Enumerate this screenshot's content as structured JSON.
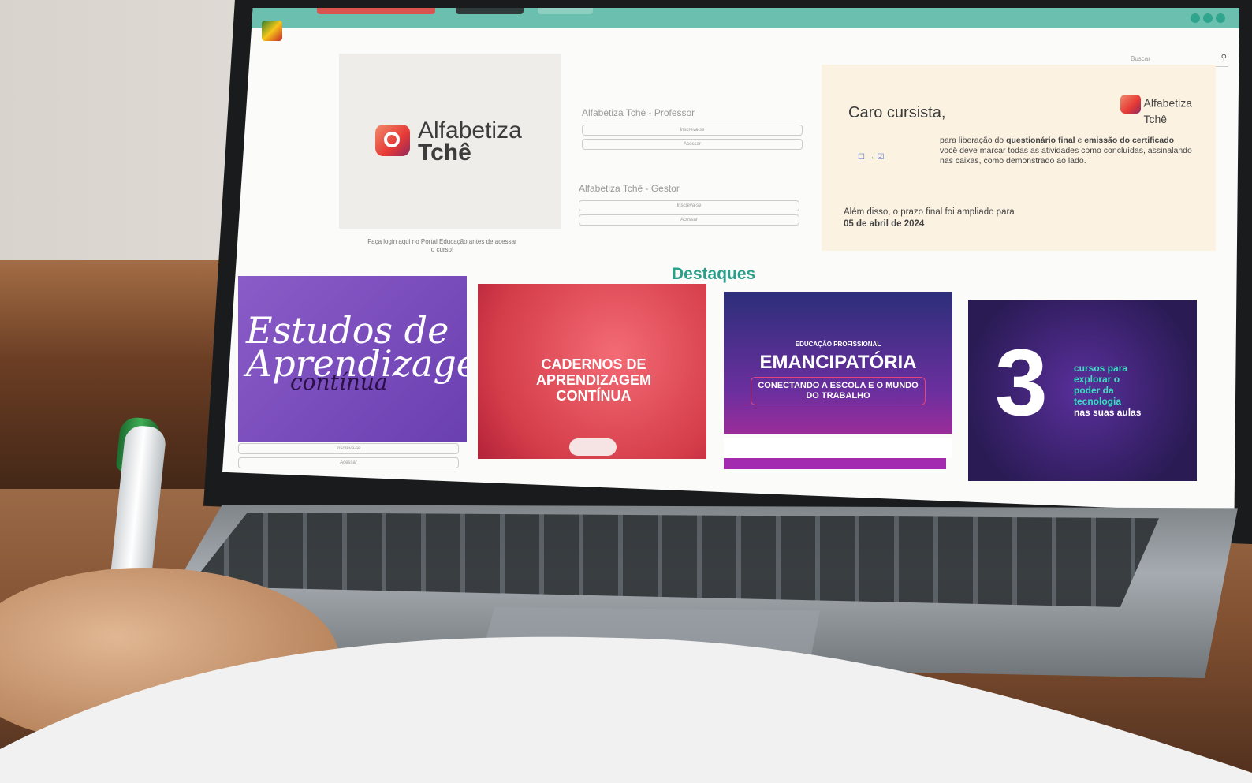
{
  "screen": {
    "search_placeholder": "Buscar",
    "brand": {
      "name_line1": "Alfabetiza",
      "name_line2": "Tchê",
      "caption": "Faça login aqui no Portal Educação antes de acessar o curso!"
    },
    "courses": [
      {
        "title": "Alfabetiza Tchê - Professor",
        "buttons": [
          "Inscreva-se",
          "Acessar"
        ]
      },
      {
        "title": "Alfabetiza Tchê - Gestor",
        "buttons": [
          "Inscreva-se",
          "Acessar"
        ]
      }
    ],
    "notice": {
      "title": "Caro cursista,",
      "body_pre": "para liberação do ",
      "body_bold1": "questionário final",
      "body_mid": " e ",
      "body_bold2": "emissão do certificado",
      "body_post": " você deve marcar todas as atividades como concluídas, assinalando nas caixas, como demonstrado ao lado.",
      "extra_pre": "Além disso, o prazo final foi ampliado para",
      "extra_bold": "05 de abril de 2024",
      "logo_line1": "Alfabetiza",
      "logo_line2": "Tchê"
    },
    "section_title": "Destaques",
    "tiles": [
      {
        "line1": "Estudos de",
        "line2": "Aprendizagem",
        "line3": "contínua",
        "buttons": [
          "Inscreva-se",
          "Acessar"
        ]
      },
      {
        "text": "CADERNOS DE APRENDIZAGEM CONTÍNUA"
      },
      {
        "kicker": "EDUCAÇÃO PROFISSIONAL",
        "title": "EMANCIPATÓRIA",
        "subtitle": "CONECTANDO A ESCOLA E O MUNDO DO TRABALHO"
      },
      {
        "number": "3",
        "line1": "cursos para",
        "line2": "explorar o",
        "line3": "poder da",
        "line4": "tecnologia",
        "line5": "nas suas aulas"
      }
    ]
  }
}
